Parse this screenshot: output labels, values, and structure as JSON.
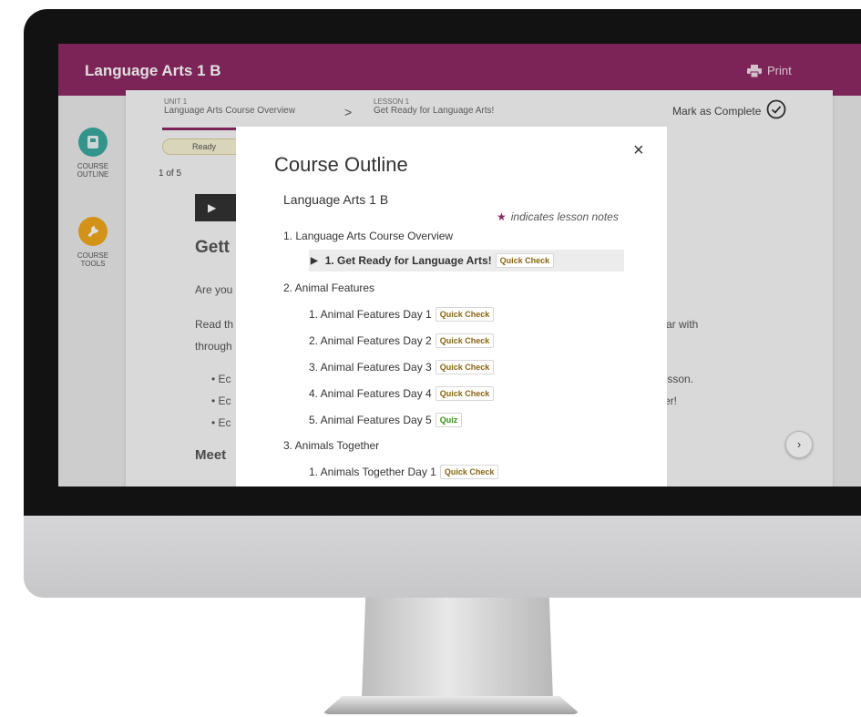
{
  "app": {
    "title": "Language Arts 1 B",
    "print_label": "Print"
  },
  "rail": {
    "outline_label": "COURSE OUTLINE",
    "tools_label": "COURSE TOOLS"
  },
  "breadcrumb": {
    "unit_small": "UNIT 1",
    "unit_name": "Language Arts Course Overview",
    "separator": ">",
    "lesson_small": "LESSON 1",
    "lesson_name": "Get Ready for Language Arts!"
  },
  "mark_complete_label": "Mark as Complete",
  "status_pill": "Ready",
  "page_count": "1 of 5",
  "background_text": {
    "heading": "Gett",
    "line1": "Are you",
    "line2a": "Read th",
    "line2b": "iliar with",
    "line3": "through",
    "bullet1a": "• Ec",
    "bullet1b": "lesson.",
    "bullet2a": "• Ec",
    "bullet2b": "ver!",
    "bullet3": "• Ec",
    "meet": "Meet"
  },
  "modal": {
    "title": "Course Outline",
    "close": "×",
    "course_name": "Language Arts 1 B",
    "notes_hint": "indicates lesson notes",
    "units": [
      {
        "label": "1. Language Arts Course Overview",
        "lessons": [
          {
            "label": "1. Get Ready for Language Arts!",
            "badge": "Quick Check",
            "active": true
          }
        ]
      },
      {
        "label": "2. Animal Features",
        "lessons": [
          {
            "label": "1. Animal Features Day 1",
            "badge": "Quick Check"
          },
          {
            "label": "2. Animal Features Day 2",
            "badge": "Quick Check"
          },
          {
            "label": "3. Animal Features Day 3",
            "badge": "Quick Check"
          },
          {
            "label": "4. Animal Features Day 4",
            "badge": "Quick Check"
          },
          {
            "label": "5. Animal Features Day 5",
            "badge": "Quiz"
          }
        ]
      },
      {
        "label": "3. Animals Together",
        "lessons": [
          {
            "label": "1. Animals Together Day 1",
            "badge": "Quick Check"
          }
        ]
      }
    ]
  },
  "colors": {
    "brand": "#8e2a63",
    "outline_icon": "#3aa99f",
    "tools_icon": "#f0a81c",
    "quick_check_text": "#8a6410",
    "quiz_text": "#3b8a1a"
  },
  "icons": {
    "print": "printer-icon",
    "outline": "book-icon",
    "tools": "wrench-icon",
    "complete": "check-circle-icon",
    "next": "chevron-right-icon",
    "active_lesson": "caret-right-icon"
  }
}
